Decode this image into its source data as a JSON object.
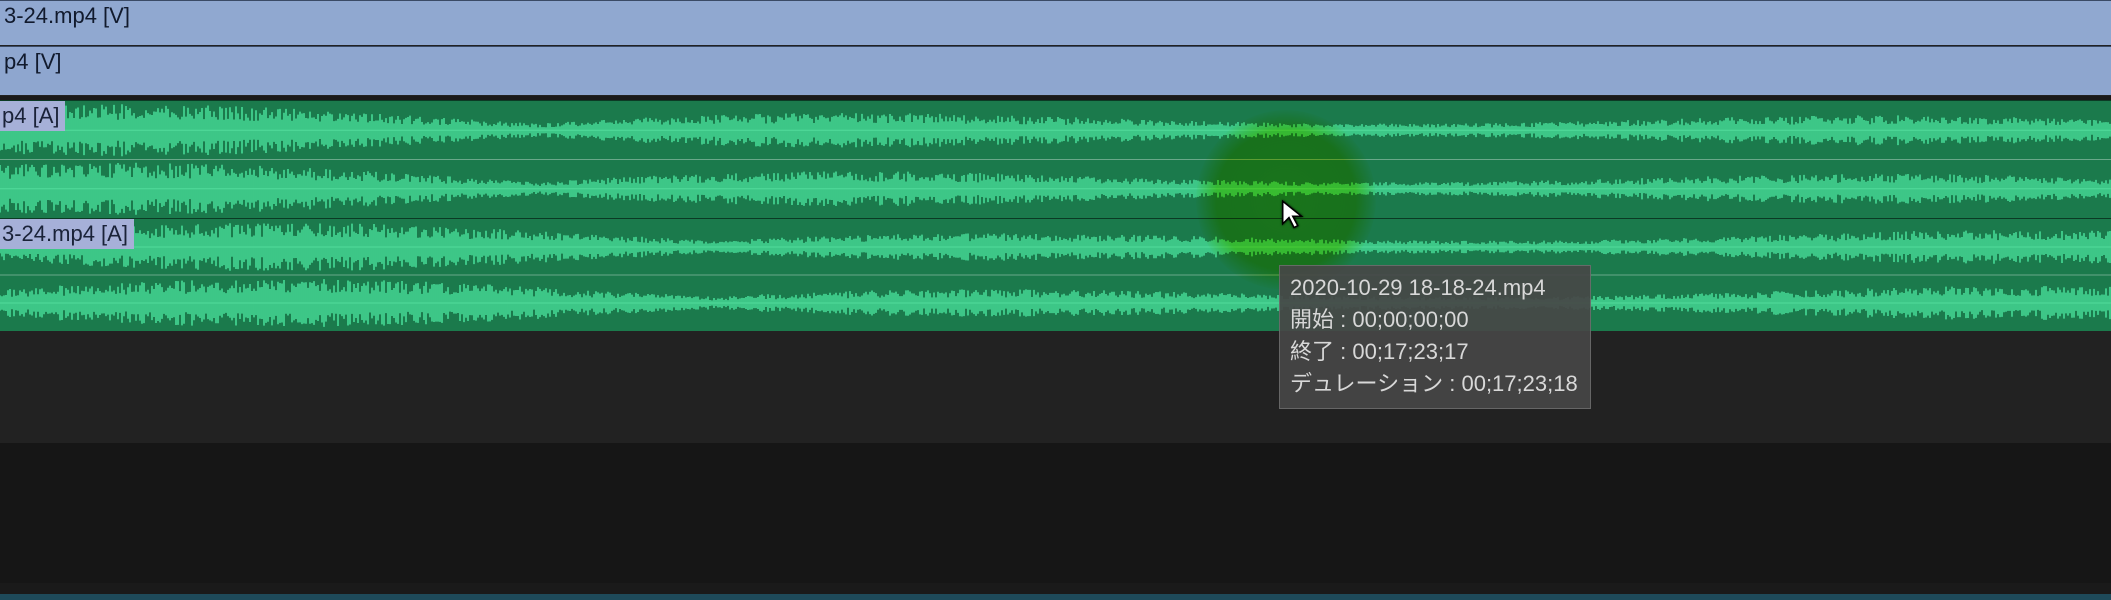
{
  "tracks": {
    "video1": {
      "label": "3-24.mp4 [V]"
    },
    "video2": {
      "label": "p4 [V]"
    },
    "audio1": {
      "label": "p4 [A]"
    },
    "audio2": {
      "label": "3-24.mp4 [A]"
    }
  },
  "tooltip": {
    "filename": "2020-10-29 18-18-24.mp4",
    "start_label": "開始",
    "start_value": "00;00;00;00",
    "end_label": "終了",
    "end_value": "00;17;23;17",
    "duration_label": "デュレーション",
    "duration_value": "00;17;23;18"
  },
  "colors": {
    "video_bg": "#90a8d0",
    "audio_bg": "#1b7a4c",
    "wave": "#49e09a",
    "wave_bright": "#6ff0b0",
    "highlight": "#dbe53a"
  }
}
